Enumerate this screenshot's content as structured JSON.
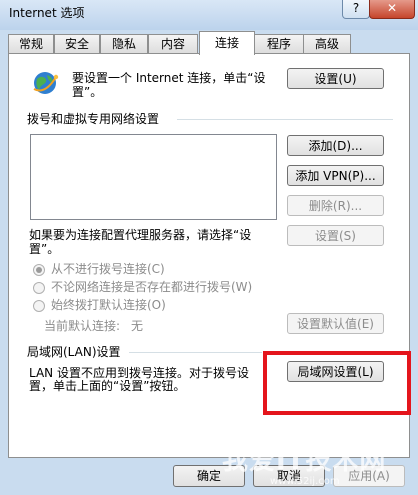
{
  "window": {
    "title": "Internet 选项",
    "help_label": "?",
    "close_label": "✕"
  },
  "tabs": [
    {
      "label": "常规"
    },
    {
      "label": "安全"
    },
    {
      "label": "隐私"
    },
    {
      "label": "内容"
    },
    {
      "label": "连接",
      "active": true
    },
    {
      "label": "程序"
    },
    {
      "label": "高级"
    }
  ],
  "setup": {
    "icon": "globe-icon",
    "text_line1": "要设置一个 Internet 连接，单击“设",
    "text_line2": "置”。",
    "button_label": "设置(U)"
  },
  "dialup": {
    "heading": "拨号和虚拟专用网络设置",
    "add_label": "添加(D)...",
    "add_vpn_label": "添加 VPN(P)...",
    "remove_label": "删除(R)...",
    "proxy_text_line1": "如果要为连接配置代理服务器，请选择“设",
    "proxy_text_line2": "置”。",
    "settings_label": "设置(S)",
    "options": [
      {
        "label": "从不进行拨号连接(C)",
        "checked": true
      },
      {
        "label": "不论网络连接是否存在都进行拨号(W)",
        "checked": false
      },
      {
        "label": "始终拨打默认连接(O)",
        "checked": false
      }
    ],
    "current_default_label": "当前默认连接:",
    "current_default_value": "无",
    "set_default_label": "设置默认值(E)"
  },
  "lan": {
    "heading": "局域网(LAN)设置",
    "text_line1": "LAN 设置不应用到拨号连接。对于拨号设",
    "text_line2": "置，单击上面的“设置”按钮。",
    "button_label": "局域网设置(L)"
  },
  "footer": {
    "ok_label": "确定",
    "cancel_label": "取消",
    "apply_label": "应用(A)"
  },
  "watermark": {
    "text": "我爱IT技术网",
    "sub": "www.52ij.com"
  },
  "colors": {
    "highlight": "#e4151c",
    "window_frame": "#c9dcef"
  }
}
